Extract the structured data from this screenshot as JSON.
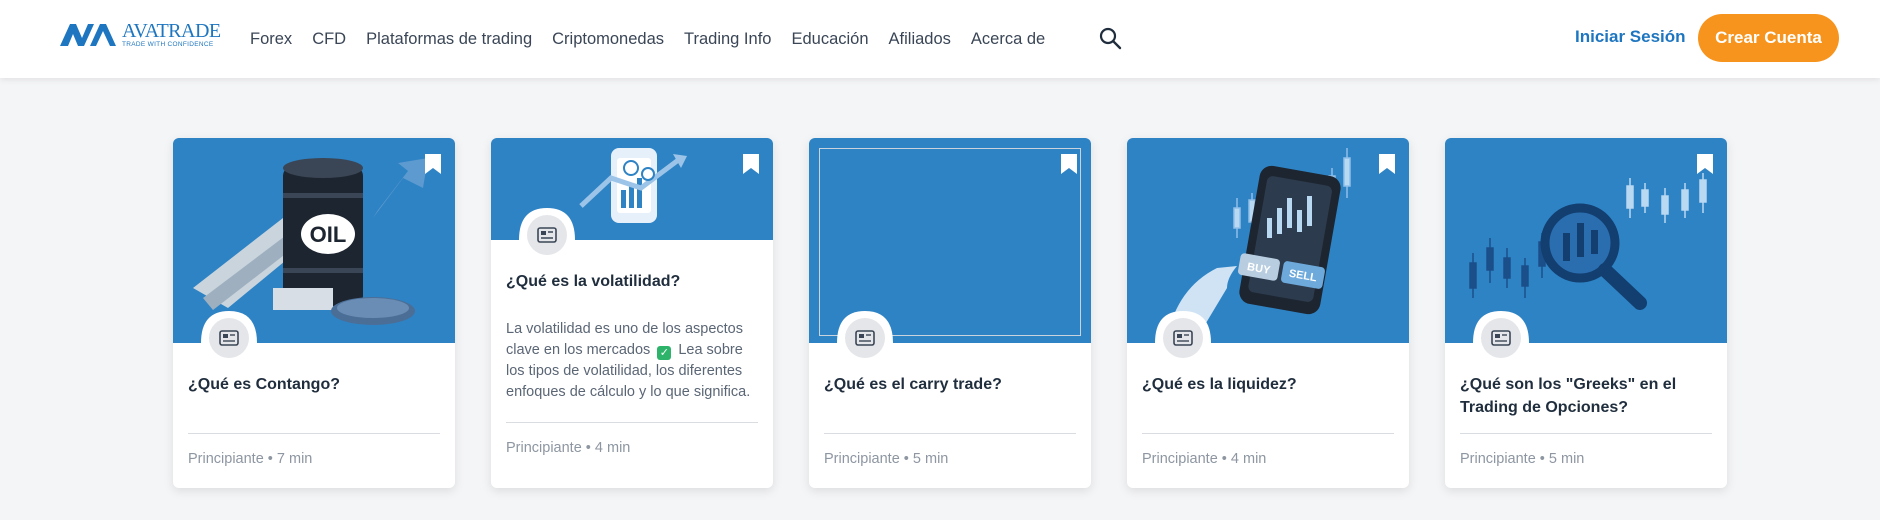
{
  "header": {
    "logo": {
      "name": "AVATRADE",
      "tagline": "TRADE WITH CONFIDENCE"
    },
    "nav": [
      "Forex",
      "CFD",
      "Plataformas de trading",
      "Criptomonedas",
      "Trading Info",
      "Educación",
      "Afiliados",
      "Acerca de"
    ],
    "search_icon": "search-icon",
    "login_label": "Iniciar Sesión",
    "signup_label": "Crear Cuenta"
  },
  "colors": {
    "brand_blue": "#1e76c0",
    "card_blue": "#2e83c4",
    "accent_orange": "#f7941d",
    "check_green": "#2db36a"
  },
  "cards": [
    {
      "title": "¿Qué es Contango?",
      "description": "",
      "level": "Principiante",
      "duration": "7 min",
      "image_icon": "oil-barrel-illustration"
    },
    {
      "title": "¿Qué es la volatilidad?",
      "description_before": "La volatilidad es uno de los aspectos clave en los mercados",
      "description_after": "Lea sobre los tipos de volatilidad, los diferentes enfoques de cálculo y lo que significa.",
      "level": "Principiante",
      "duration": "4 min",
      "image_icon": "phone-chart-illustration"
    },
    {
      "title": "¿Qué es el carry trade?",
      "description": "",
      "level": "Principiante",
      "duration": "5 min",
      "image_icon": "broken-image-icon"
    },
    {
      "title": "¿Qué es la liquidez?",
      "description": "",
      "level": "Principiante",
      "duration": "4 min",
      "image_icon": "phone-buy-sell-illustration",
      "image_text_buy": "BUY",
      "image_text_sell": "SELL"
    },
    {
      "title": "¿Qué son los \"Greeks\" en el Trading de Opciones?",
      "description": "",
      "level": "Principiante",
      "duration": "5 min",
      "image_icon": "magnifier-chart-illustration"
    }
  ],
  "meta_separator": "•"
}
